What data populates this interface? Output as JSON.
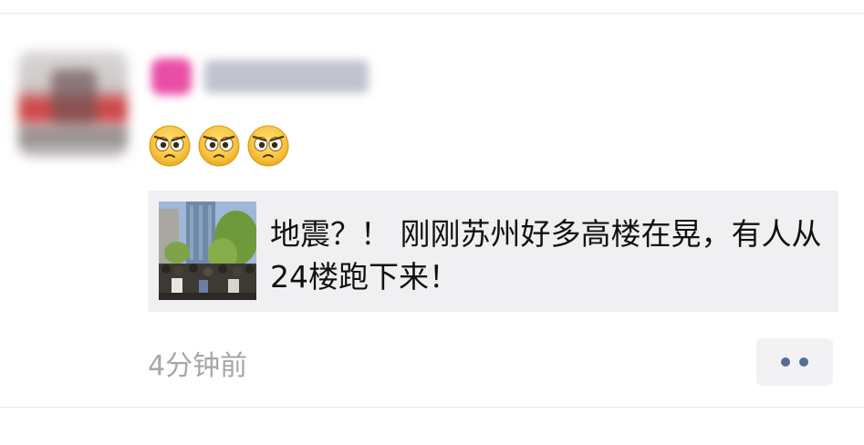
{
  "post": {
    "emoji_row": [
      "angry-face-icon",
      "angry-face-icon",
      "angry-face-icon"
    ],
    "shared_link": {
      "text": "地震？！ 刚刚苏州好多高楼在晃，有人从24楼跑下来！"
    },
    "time": "4分钟前",
    "more_button": {
      "icon": "more-dots-icon"
    }
  },
  "colors": {
    "background": "#ffffff",
    "card_background": "#f0f0f3",
    "time_gray": "#a6a6ab",
    "more_dot_blue": "#586b95"
  }
}
